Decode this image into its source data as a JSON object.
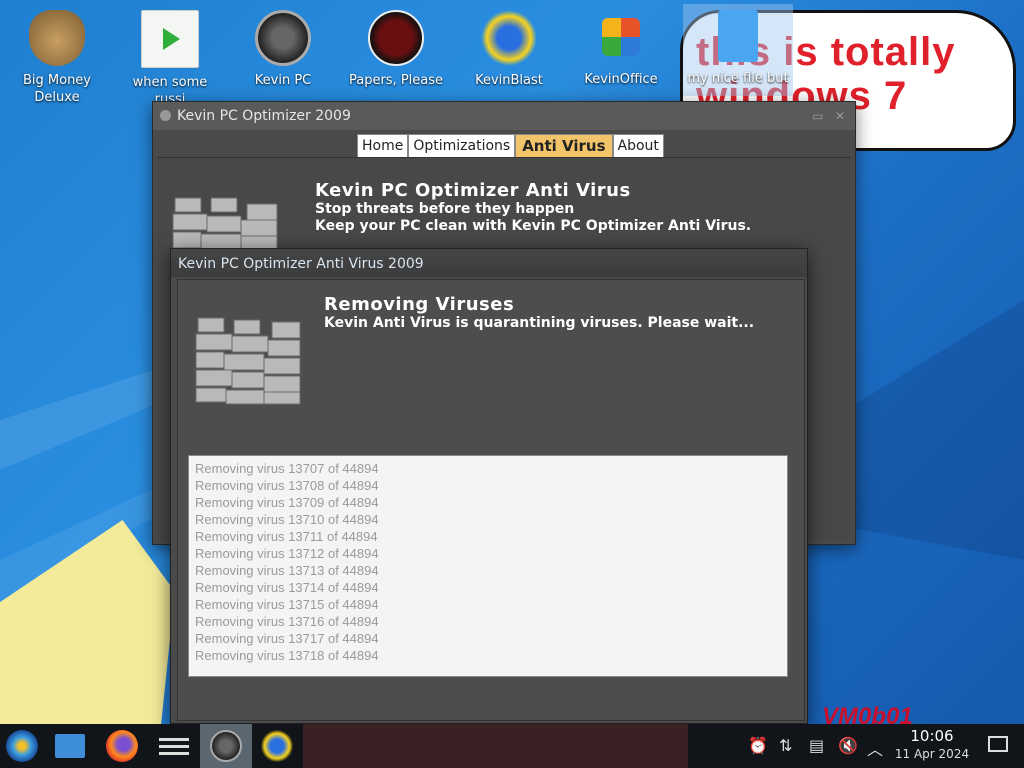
{
  "desktop": {
    "icons": [
      {
        "label": "Big Money\nDeluxe"
      },
      {
        "label": "when some\nrussi"
      },
      {
        "label": "Kevin PC"
      },
      {
        "label": "Papers, Please"
      },
      {
        "label": "KevinBlast"
      },
      {
        "label": "KevinOffice"
      },
      {
        "label": "my nice file but"
      }
    ],
    "speech_text": "this is totally windows 7 guys",
    "watermark": "VM0b01"
  },
  "main_window": {
    "title": "Kevin PC Optimizer 2009",
    "tabs": [
      {
        "label": "Home"
      },
      {
        "label": "Optimizations"
      },
      {
        "label": "Anti Virus"
      },
      {
        "label": "About"
      }
    ],
    "active_tab": "Anti Virus",
    "heading": "Kevin PC Optimizer Anti Virus",
    "sub1": "Stop threats before they happen",
    "sub2": "Keep your PC clean with Kevin PC Optimizer Anti Virus."
  },
  "dialog": {
    "title": "Kevin PC Optimizer Anti Virus 2009",
    "heading": "Removing Viruses",
    "message": "Kevin Anti Virus is quarantining viruses. Please wait...",
    "log": [
      "Removing virus 13707 of 44894",
      "Removing virus 13708 of 44894",
      "Removing virus 13709 of 44894",
      "Removing virus 13710 of 44894",
      "Removing virus 13711 of 44894",
      "Removing virus 13712 of 44894",
      "Removing virus 13713 of 44894",
      "Removing virus 13714 of 44894",
      "Removing virus 13715 of 44894",
      "Removing virus 13716 of 44894",
      "Removing virus 13717 of 44894",
      "Removing virus 13718 of 44894"
    ]
  },
  "taskbar": {
    "time": "10:06",
    "date": "11 Apr 2024",
    "items": [
      "start-orb-icon",
      "file-manager-icon",
      "firefox-icon",
      "settings-icon",
      "kevin-pc-optimizer-icon",
      "kevinblast-icon"
    ]
  },
  "colors": {
    "active_tab": "#f3c46a",
    "speech_text": "#e0202a",
    "log_text": "#9a9a9a"
  }
}
